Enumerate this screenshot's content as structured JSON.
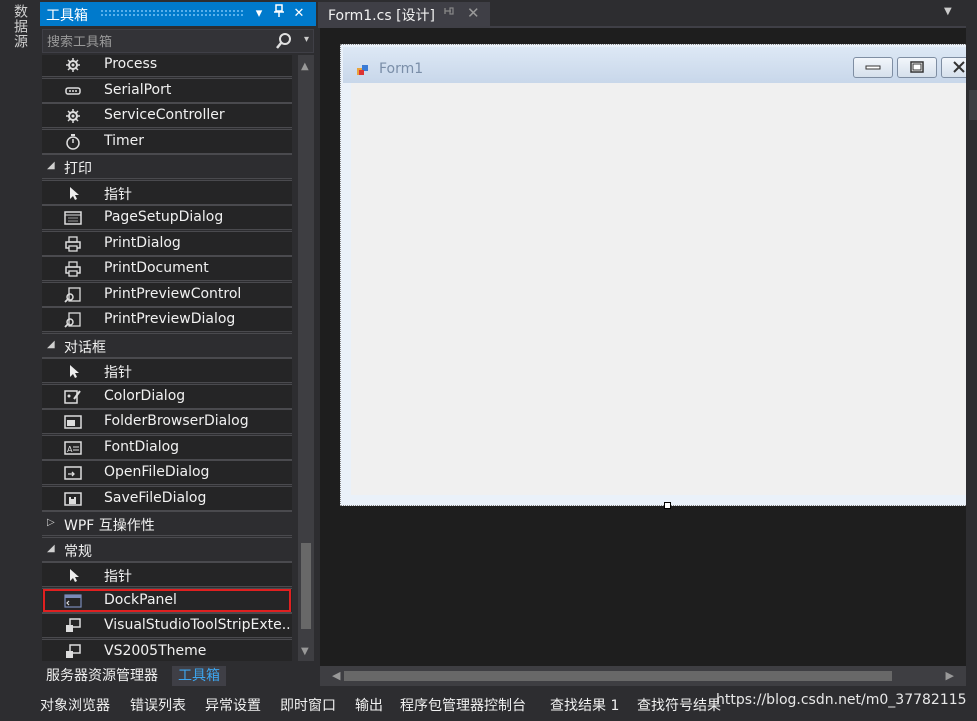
{
  "sidebar_left": {
    "tab_label": "数据源"
  },
  "toolbox": {
    "title": "工具箱",
    "search_placeholder": "搜索工具箱",
    "items": [
      {
        "label": "Process",
        "type": "item",
        "icon": "gear-icon"
      },
      {
        "label": "SerialPort",
        "type": "item",
        "icon": "serial-port-icon"
      },
      {
        "label": "ServiceController",
        "type": "item",
        "icon": "gear-icon"
      },
      {
        "label": "Timer",
        "type": "item",
        "icon": "stopwatch-icon"
      },
      {
        "label": "打印",
        "type": "category",
        "expanded": true
      },
      {
        "label": "指针",
        "type": "item",
        "icon": "pointer-icon"
      },
      {
        "label": "PageSetupDialog",
        "type": "item",
        "icon": "page-setup-icon"
      },
      {
        "label": "PrintDialog",
        "type": "item",
        "icon": "printer-icon"
      },
      {
        "label": "PrintDocument",
        "type": "item",
        "icon": "printer-icon"
      },
      {
        "label": "PrintPreviewControl",
        "type": "item",
        "icon": "print-preview-icon"
      },
      {
        "label": "PrintPreviewDialog",
        "type": "item",
        "icon": "print-preview-icon"
      },
      {
        "label": "对话框",
        "type": "category",
        "expanded": true
      },
      {
        "label": "指针",
        "type": "item",
        "icon": "pointer-icon"
      },
      {
        "label": "ColorDialog",
        "type": "item",
        "icon": "color-dialog-icon"
      },
      {
        "label": "FolderBrowserDialog",
        "type": "item",
        "icon": "folder-dialog-icon"
      },
      {
        "label": "FontDialog",
        "type": "item",
        "icon": "font-dialog-icon"
      },
      {
        "label": "OpenFileDialog",
        "type": "item",
        "icon": "open-file-icon"
      },
      {
        "label": "SaveFileDialog",
        "type": "item",
        "icon": "save-file-icon"
      },
      {
        "label": "WPF 互操作性",
        "type": "category",
        "expanded": false
      },
      {
        "label": "常规",
        "type": "category",
        "expanded": true
      },
      {
        "label": "指针",
        "type": "item",
        "icon": "pointer-icon"
      },
      {
        "label": "DockPanel",
        "type": "item",
        "icon": "dock-panel-icon",
        "selected": true
      },
      {
        "label": "VisualStudioToolStripExte...",
        "type": "item",
        "icon": "component-icon"
      },
      {
        "label": "VS2005Theme",
        "type": "item",
        "icon": "component-icon"
      }
    ],
    "bottom_tabs": [
      "服务器资源管理器",
      "工具箱"
    ],
    "active_tab": "工具箱"
  },
  "document": {
    "tab_label": "Form1.cs [设计]",
    "form_title": "Form1"
  },
  "bottom_bar": {
    "tabs": [
      "对象浏览器",
      "错误列表",
      "异常设置",
      "即时窗口",
      "输出",
      "程序包管理器控制台",
      "查找结果 1",
      "查找符号结果"
    ]
  },
  "watermark": "https://blog.csdn.net/m0_37782115",
  "colors": {
    "accent": "#007acc",
    "background": "#2d2d30",
    "list_bg": "#252526",
    "selection_outline": "#e02020",
    "form_bg": "#f0f0f0"
  }
}
